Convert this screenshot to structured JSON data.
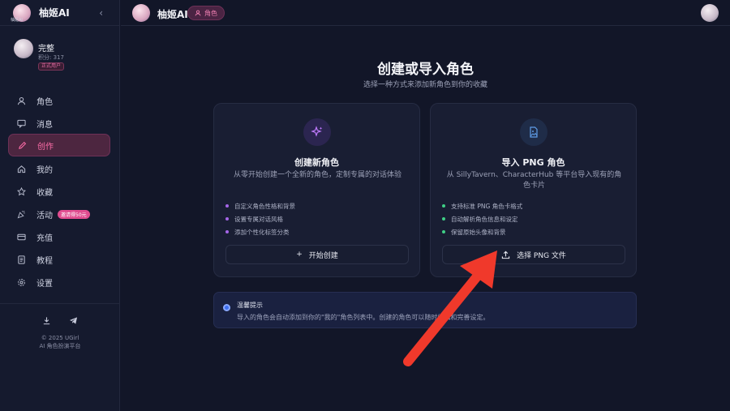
{
  "sidebar": {
    "brand": "柚姬AI",
    "logo_tag": "柚姬AI",
    "user": {
      "name": "完整",
      "points": "积分: 317",
      "badge": "正式用户"
    },
    "items": [
      {
        "label": "角色",
        "icon": "user-icon"
      },
      {
        "label": "消息",
        "icon": "message-icon"
      },
      {
        "label": "创作",
        "icon": "pencil-icon",
        "active": true
      },
      {
        "label": "我的",
        "icon": "home-icon"
      },
      {
        "label": "收藏",
        "icon": "star-icon"
      },
      {
        "label": "活动",
        "icon": "party-icon",
        "badge": "邀请得50元"
      },
      {
        "label": "充值",
        "icon": "card-icon"
      },
      {
        "label": "教程",
        "icon": "doc-icon"
      },
      {
        "label": "设置",
        "icon": "gear-icon"
      }
    ],
    "footer": {
      "copyright": "© 2025 UGirl",
      "tagline": "AI 角色扮演平台"
    }
  },
  "topbar": {
    "title": "柚姬AI",
    "pill": "角色"
  },
  "main": {
    "title": "创建或导入角色",
    "subtitle": "选择一种方式来添加新角色到你的收藏",
    "create_card": {
      "title": "创建新角色",
      "desc": "从零开始创建一个全新的角色，定制专属的对话体验",
      "features": [
        "自定义角色性格和背景",
        "设置专属对话风格",
        "添加个性化标签分类"
      ],
      "button": "开始创建",
      "button_icon": "+"
    },
    "import_card": {
      "title": "导入 PNG 角色",
      "desc": "从 SillyTavern、CharacterHub 等平台导入现有的角色卡片",
      "features": [
        "支持标准 PNG 角色卡格式",
        "自动解析角色信息和设定",
        "保留原始头像和背景"
      ],
      "button": "选择 PNG 文件"
    },
    "tip": {
      "title": "温馨提示",
      "text": "导入的角色会自动添加到你的\"我的\"角色列表中。创建的角色可以随时编辑和完善设定。"
    }
  },
  "colors": {
    "accent": "#ff6ea9",
    "background": "#121628",
    "annotation_arrow": "#f0392b"
  }
}
